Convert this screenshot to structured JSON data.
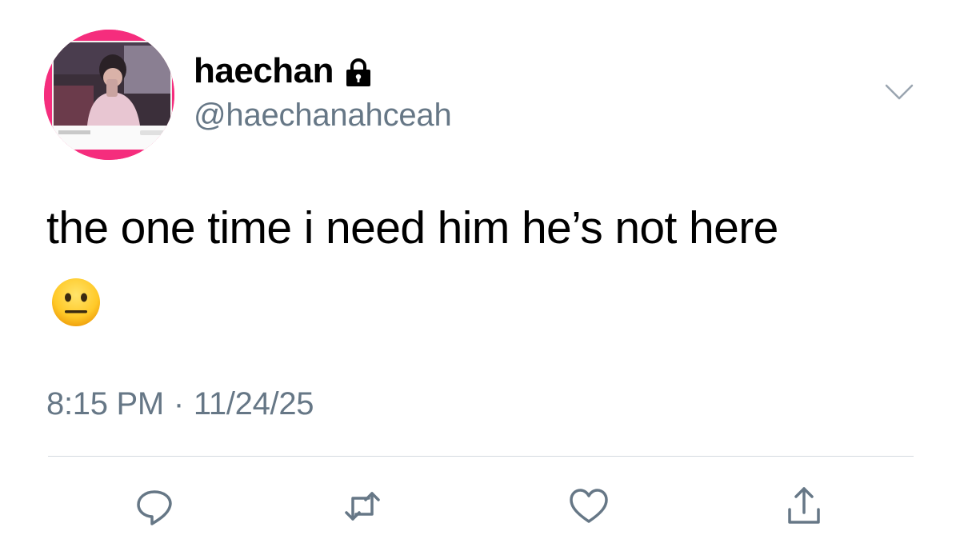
{
  "user": {
    "display_name": "haechan",
    "handle": "@haechanahceah",
    "protected_icon": "lock-icon",
    "avatar": "profile-photo"
  },
  "tweet": {
    "text": "the one time i need him he’s not here",
    "emoji": "neutral-face-emoji",
    "time": "8:15 PM",
    "separator": "·",
    "date": "11/24/25"
  },
  "actions": [
    {
      "name": "reply",
      "icon": "reply-icon"
    },
    {
      "name": "retweet",
      "icon": "retweet-icon"
    },
    {
      "name": "like",
      "icon": "heart-icon"
    },
    {
      "name": "share",
      "icon": "share-icon"
    }
  ],
  "colors": {
    "text": "#000000",
    "secondary": "#667786",
    "divider": "#d4dadf",
    "avatar_accent": "#f52d7d"
  }
}
